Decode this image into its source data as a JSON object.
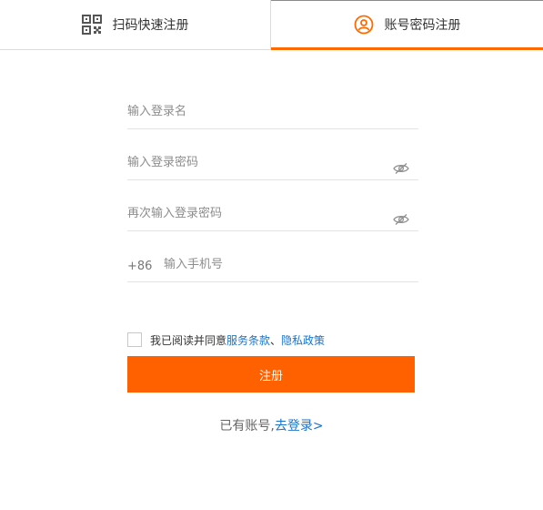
{
  "tabs": [
    {
      "label": "扫码快速注册",
      "icon": "qr-code-icon",
      "active": false
    },
    {
      "label": "账号密码注册",
      "icon": "user-circle-icon",
      "active": true
    }
  ],
  "form": {
    "username_placeholder": "输入登录名",
    "password_placeholder": "输入登录密码",
    "confirm_placeholder": "再次输入登录密码",
    "phone_prefix": "+86",
    "phone_placeholder": "输入手机号",
    "eye_icon": "eye-hidden-icon"
  },
  "agreement": {
    "prefix": "我已阅读并同意",
    "terms": "服务条款",
    "separator": "、",
    "privacy": "隐私政策",
    "checked": false
  },
  "submit_label": "注册",
  "login_prompt": {
    "text": "已有账号,",
    "link": "去登录>"
  },
  "colors": {
    "accent": "#ff6000",
    "link": "#1a73c9",
    "tab_icon_active": "#ff6a00"
  }
}
